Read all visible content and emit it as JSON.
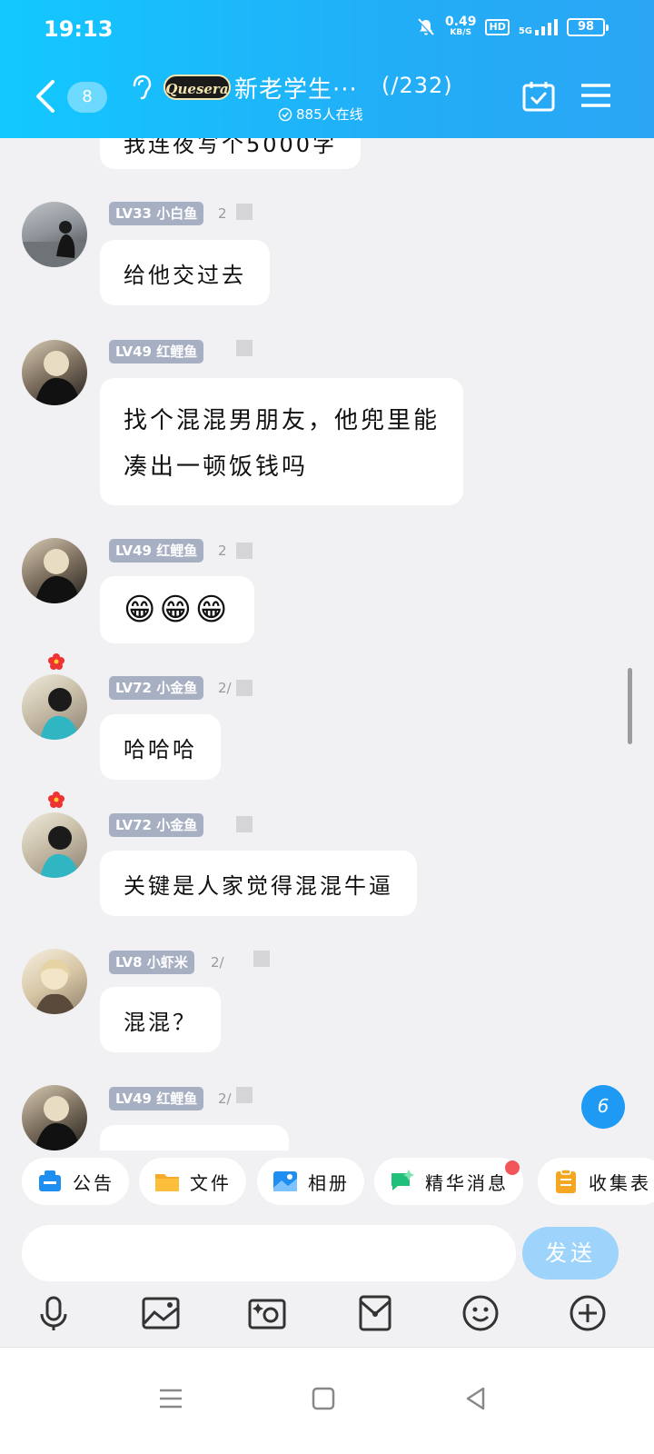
{
  "status_bar": {
    "time": "19:13",
    "net_speed_value": "0.49",
    "net_speed_unit": "KB/S",
    "hd_label": "HD",
    "signal_label": "5G",
    "battery": "98"
  },
  "header": {
    "unread_count": "8",
    "logo_text": "Quesera",
    "group_title": "新老学生···",
    "member_count": "(/232)",
    "online_text": "885人在线"
  },
  "messages": [
    {
      "partial_text": "我连夜写个5000字"
    },
    {
      "level": "LV33 小白鱼",
      "meta": "2",
      "text": "给他交过去"
    },
    {
      "level": "LV49 红鲤鱼",
      "meta": "",
      "text_line1": "找个混混男朋友，他兜里能",
      "text_line2": "凑出一顿饭钱吗"
    },
    {
      "level": "LV49 红鲤鱼",
      "meta": "2",
      "text": "😁😁😁"
    },
    {
      "level": "LV72 小金鱼",
      "meta": "2/",
      "text": "哈哈哈"
    },
    {
      "level": "LV72 小金鱼",
      "meta": "",
      "text": "关键是人家觉得混混牛逼"
    },
    {
      "level": "LV8 小虾米",
      "meta": "2/",
      "text": "混混？"
    },
    {
      "level": "LV49 红鲤鱼",
      "meta": "2/",
      "text": ""
    }
  ],
  "new_message_count": "6",
  "shortcuts": [
    {
      "label": "公告",
      "icon": "announcement-icon"
    },
    {
      "label": "文件",
      "icon": "folder-icon"
    },
    {
      "label": "相册",
      "icon": "album-icon"
    },
    {
      "label": "精华消息",
      "icon": "highlight-message-icon"
    },
    {
      "label": "收集表",
      "icon": "clipboard-icon"
    }
  ],
  "input": {
    "placeholder": "",
    "send_label": "发送"
  },
  "colors": {
    "header_start": "#12c8ff",
    "header_end": "#2aa6f5",
    "send_button": "#9ed4fb",
    "level_badge": "#a7afc3"
  }
}
